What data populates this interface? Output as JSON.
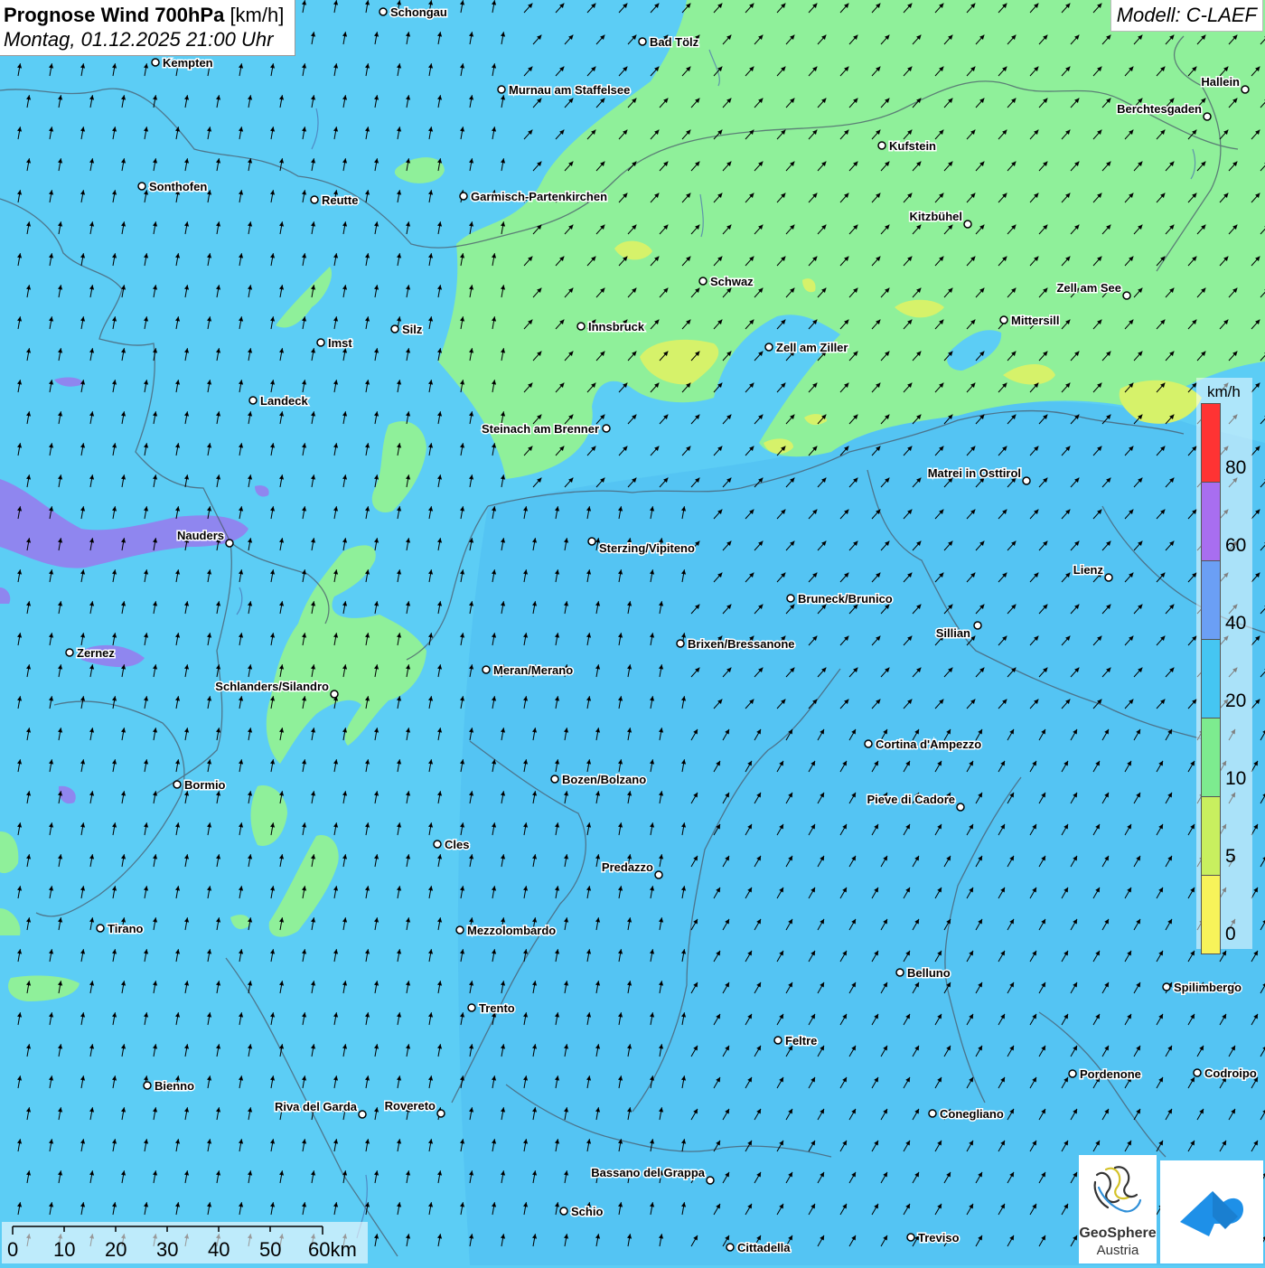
{
  "title": {
    "main": "Prognose Wind 700hPa",
    "unit": "[km/h]",
    "datetime": "Montag, 01.12.2025 21:00 Uhr"
  },
  "model": "Modell: C-LAEF",
  "legend": {
    "unit": "km/h",
    "values": [
      "80",
      "60",
      "40",
      "20",
      "10",
      "5",
      "0"
    ],
    "colors": [
      "#ff3333",
      "#a86ef0",
      "#6b9ff5",
      "#45c6f2",
      "#7deb8f",
      "#c8ef5f",
      "#f7f35a"
    ]
  },
  "scale": {
    "labels": [
      "0",
      "10",
      "20",
      "30",
      "40",
      "50",
      "60km"
    ]
  },
  "logo": {
    "line1": "GeoSphere",
    "line2": "Austria"
  },
  "field_colors": {
    "blue": "#5ccdf5",
    "blue_dark": "#52c2f2",
    "green": "#8ff09a",
    "yellow": "#d6f26a",
    "purple": "#8f86ef"
  },
  "wind_arrow_icon": "northeast-arrow-icon",
  "cities": [
    {
      "name": "Schongau"
    },
    {
      "name": "Bad Tölz"
    },
    {
      "name": "Kempten"
    },
    {
      "name": "Murnau am Staffelsee"
    },
    {
      "name": "Hallein"
    },
    {
      "name": "Berchtesgaden"
    },
    {
      "name": "Kufstein"
    },
    {
      "name": "Sonthofen"
    },
    {
      "name": "Reutte"
    },
    {
      "name": "Garmisch-Partenkirchen"
    },
    {
      "name": "Kitzbühel"
    },
    {
      "name": "Schwaz"
    },
    {
      "name": "Zell am See"
    },
    {
      "name": "Innsbruck"
    },
    {
      "name": "Mittersill"
    },
    {
      "name": "Imst"
    },
    {
      "name": "Silz"
    },
    {
      "name": "Zell am Ziller"
    },
    {
      "name": "Landeck"
    },
    {
      "name": "Steinach am Brenner"
    },
    {
      "name": "Matrei in Osttirol"
    },
    {
      "name": "Nauders"
    },
    {
      "name": "Sterzing/Vipiteno"
    },
    {
      "name": "Lienz"
    },
    {
      "name": "Bruneck/Brunico"
    },
    {
      "name": "Sillian"
    },
    {
      "name": "Zernez"
    },
    {
      "name": "Brixen/Bressanone"
    },
    {
      "name": "Meran/Merano"
    },
    {
      "name": "Schlanders/Silandro"
    },
    {
      "name": "Cortina d'Ampezzo"
    },
    {
      "name": "Bormio"
    },
    {
      "name": "Bozen/Bolzano"
    },
    {
      "name": "Pieve di Cadore"
    },
    {
      "name": "Cles"
    },
    {
      "name": "Predazzo"
    },
    {
      "name": "Tirano"
    },
    {
      "name": "Mezzolombardo"
    },
    {
      "name": "Belluno"
    },
    {
      "name": "Spilimbergo"
    },
    {
      "name": "Trento"
    },
    {
      "name": "Feltre"
    },
    {
      "name": "Pordenone"
    },
    {
      "name": "Codroipo"
    },
    {
      "name": "Bienno"
    },
    {
      "name": "Riva del Garda"
    },
    {
      "name": "Rovereto"
    },
    {
      "name": "Conegliano"
    },
    {
      "name": "Bassano del Grappa"
    },
    {
      "name": "Schio"
    },
    {
      "name": "Treviso"
    },
    {
      "name": "Cittadella"
    }
  ]
}
